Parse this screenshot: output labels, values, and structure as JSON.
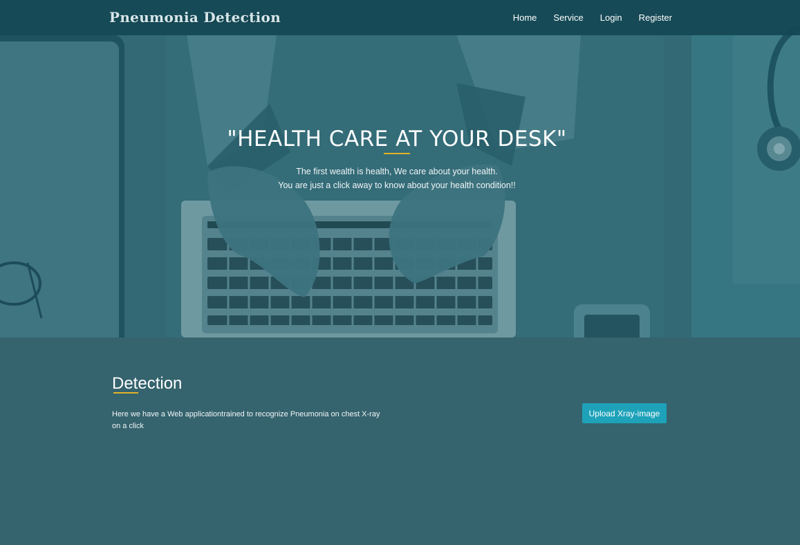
{
  "navbar": {
    "brand": "Pneumonia Detection",
    "links": [
      "Home",
      "Service",
      "Login",
      "Register"
    ]
  },
  "hero": {
    "title": "\"HEALTH CARE AT YOUR DESK\"",
    "subtitle_line1": "The first wealth is health, We care about your health.",
    "subtitle_line2": "You are just a click away to know about your health condition!!"
  },
  "detection": {
    "title": "Detection",
    "description": "Here we have a Web applicationtrained to recognize Pneumonia on chest X-ray on a click",
    "upload_label": "Upload Xray-image"
  },
  "colors": {
    "navbar_bg": "#144854",
    "page_bg": "#35636e",
    "accent_underline": "#e2b325",
    "button_bg": "#1ea2b9"
  }
}
